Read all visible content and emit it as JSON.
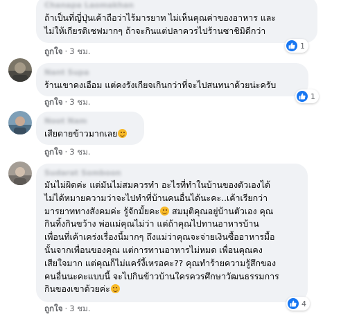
{
  "comments": [
    {
      "author": "Chanapa Laomakhan",
      "lines": [
        "ถ้าเป็นที่ญี่ปุ่นเค้าถือว่าไร้มารยาท ไม่เห็นคุณค่าของอาหาร และ",
        "ไม่ให้เกียรติเชฟมากๆ ถ้าจะกินแต่ปลาควรไปร้านซาชิมิดีกว่า"
      ],
      "like_label": "ถูกใจ",
      "time": "3 ชม.",
      "reaction_count": "1"
    },
    {
      "author": "Nant Supa",
      "lines": [
        "ร้านเขาคงเอือม แต่คงรังเกียจเกินกว่าที่จะไปสนทนาด้วยน่ะครับ"
      ],
      "like_label": "ถูกใจ",
      "time": "3 ชม.",
      "reaction_count": "1"
    },
    {
      "author": "Noot Nam",
      "lines": [
        "เสียดายข้าวมากเลย"
      ],
      "like_label": "ถูกใจ",
      "time": "3 ชม.",
      "emoji": "smiling-face-icon"
    },
    {
      "author": "Sudarat Somboon",
      "lines": [
        "มันไม่ผิดค่ะ แต่มันไม่สมควรทำ อะไรที่ทำในบ้านของตัวเองได้",
        "ไม่ได้หมายความว่าจะไปทำที่บ้านคนอื่นได้นะคะ..เค้าเรียกว่า",
        "มารยาททางสังคมค่ะ รู้จักมั้ยคะ",
        "กินทิ้งกินขว้าง พ่อแม่คุณไม่ว่า แต่ถ้าคุณไปทานอาหารบ้าน",
        "เพื่อนที่เค้าเคร่งเรื่องนี้มากๆ ถึงแม่ว่าคุณจะจ่ายเงินซื้ออาหารมื้อ",
        "นั้นจากเพื่อนของคุณ แต่การทานอาหารไม่หมด เพื่อนคุณคง",
        "เสียใจมาก แต่คุณก็ไม่แคร์งี้เหรอคะ?? คุณทำร้ายความรู้สึกของ",
        "คนอื่นนะคะแบบนี้ จะไปกินข้าวบ้านใครควรศึกษาวัฒนธรรมการ",
        "กินของเขาด้วยค่ะ"
      ],
      "line3_tail": "สมมุติคุณอยู่บ้านตัวเอง คุณ",
      "like_label": "ถูกใจ",
      "time": "3 ชม.",
      "reaction_count": "4"
    }
  ],
  "colors": {
    "bubble": "#f0f2f5",
    "meta_text": "#65676b",
    "like_blue": "#1877f2",
    "emoji_yellow": "#f7b928"
  },
  "icons": {
    "reaction": "like-thumb-icon",
    "emoji": "smiling-face-icon"
  }
}
